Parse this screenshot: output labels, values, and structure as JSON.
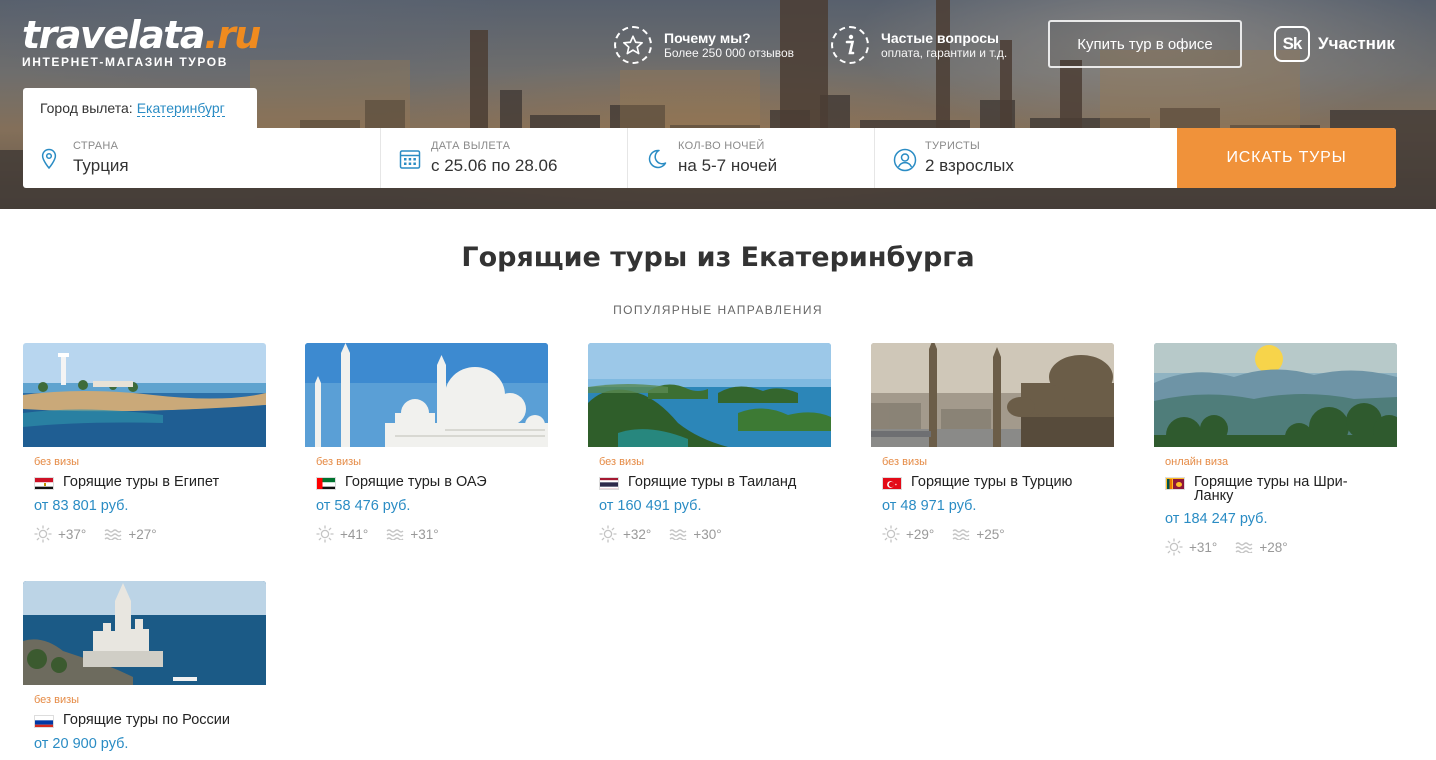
{
  "header": {
    "logo_main": "travelata",
    "logo_suffix": ".ru",
    "logo_tagline": "ИНТЕРНЕТ-МАГАЗИН ТУРОВ",
    "why_title": "Почему мы?",
    "why_sub": "Более 250 000 отзывов",
    "faq_title": "Частые вопросы",
    "faq_sub": "оплата, гарантии и т.д.",
    "office_button": "Купить тур в офисе",
    "sk_logo": "Sk",
    "sk_label": "Участник"
  },
  "search": {
    "departure_label": "Город вылета:",
    "departure_city": "Екатеринбург",
    "fields": [
      {
        "label": "СТРАНА",
        "value": "Турция"
      },
      {
        "label": "ДАТА ВЫЛЕТА",
        "value": "с 25.06 по 28.06"
      },
      {
        "label": "КОЛ-ВО НОЧЕЙ",
        "value": "на 5-7 ночей"
      },
      {
        "label": "ТУРИСТЫ",
        "value": "2 взрослых"
      }
    ],
    "submit": "ИСКАТЬ ТУРЫ"
  },
  "main": {
    "title": "Горящие туры из Екатеринбурга",
    "section_label": "ПОПУЛЯРНЫЕ НАПРАВЛЕНИЯ",
    "cards": [
      {
        "badge": "без визы",
        "name": "Горящие туры в Египет",
        "price": "от 83 801 руб.",
        "air": "+37°",
        "water": "+27°"
      },
      {
        "badge": "без визы",
        "name": "Горящие туры в ОАЭ",
        "price": "от 58 476 руб.",
        "air": "+41°",
        "water": "+31°"
      },
      {
        "badge": "без визы",
        "name": "Горящие туры в Таиланд",
        "price": "от 160 491 руб.",
        "air": "+32°",
        "water": "+30°"
      },
      {
        "badge": "без визы",
        "name": "Горящие туры в Турцию",
        "price": "от 48 971 руб.",
        "air": "+29°",
        "water": "+25°"
      },
      {
        "badge": "онлайн виза",
        "name": "Горящие туры на Шри-Ланку",
        "price": "от 184 247 руб.",
        "air": "+31°",
        "water": "+28°"
      },
      {
        "badge": "без визы",
        "name": "Горящие туры по России",
        "price": "от 20 900 руб."
      }
    ]
  },
  "colors": {
    "accent_orange": "#f0923a",
    "link_blue": "#2a8cc4",
    "badge_orange": "#e58a44"
  }
}
